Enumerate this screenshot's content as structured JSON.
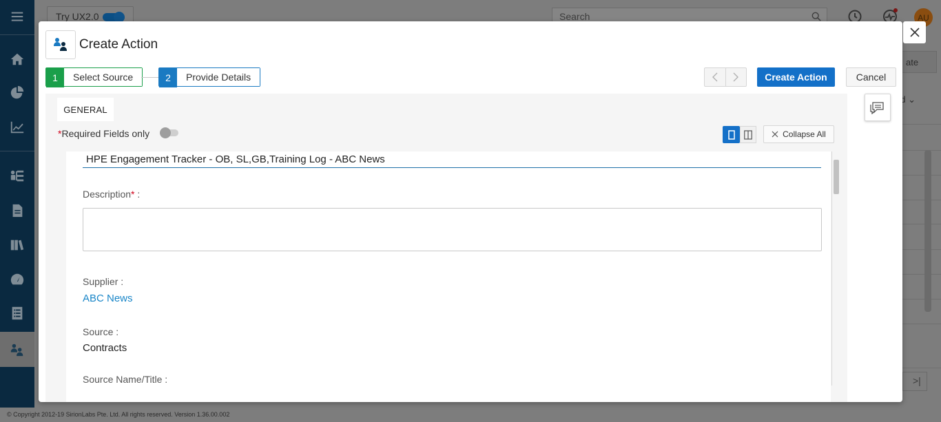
{
  "background": {
    "try_ux_label": "Try UX2.0",
    "search_placeholder": "Search",
    "avatar_initials": "AU",
    "right_button_fragment": "ate",
    "right_text_fragment": "nd",
    "last_page_glyph": ">|",
    "footer_text": "© Copyright 2012-19 SirionLabs Pte. Ltd. All rights reserved. Version 1.36.00.002"
  },
  "sidebar": {
    "items": [
      {
        "icon": "menu-icon"
      },
      {
        "icon": "home-icon"
      },
      {
        "icon": "pie-chart-icon"
      },
      {
        "icon": "line-chart-icon"
      },
      {
        "icon": "hierarchy-icon"
      },
      {
        "icon": "document-icon"
      },
      {
        "icon": "books-icon"
      },
      {
        "icon": "speedometer-icon"
      },
      {
        "icon": "list-icon"
      },
      {
        "icon": "actions-icon",
        "active": true
      }
    ]
  },
  "modal": {
    "title": "Create Action",
    "steps": [
      {
        "number": "1",
        "label": "Select Source",
        "color": "#1a9f4a"
      },
      {
        "number": "2",
        "label": "Provide Details",
        "color": "#1a7ac2"
      }
    ],
    "create_button": "Create Action",
    "cancel_button": "Cancel",
    "tab_general": "GENERAL",
    "required_toggle_label": "Required Fields only",
    "collapse_all": "Collapse All",
    "form": {
      "title_value": "HPE Engagement Tracker - OB, SL,GB,Training Log - ABC News",
      "description_label": "Description",
      "description_value": "",
      "supplier_label": "Supplier :",
      "supplier_value": "ABC News",
      "source_label": "Source :",
      "source_value": "Contracts",
      "source_name_label": "Source Name/Title :"
    }
  },
  "colors": {
    "primary": "#1370c8",
    "step_done": "#1a9f4a",
    "step_active": "#1a7ac2",
    "link": "#1a86c8",
    "sidebar": "#0a2940"
  }
}
